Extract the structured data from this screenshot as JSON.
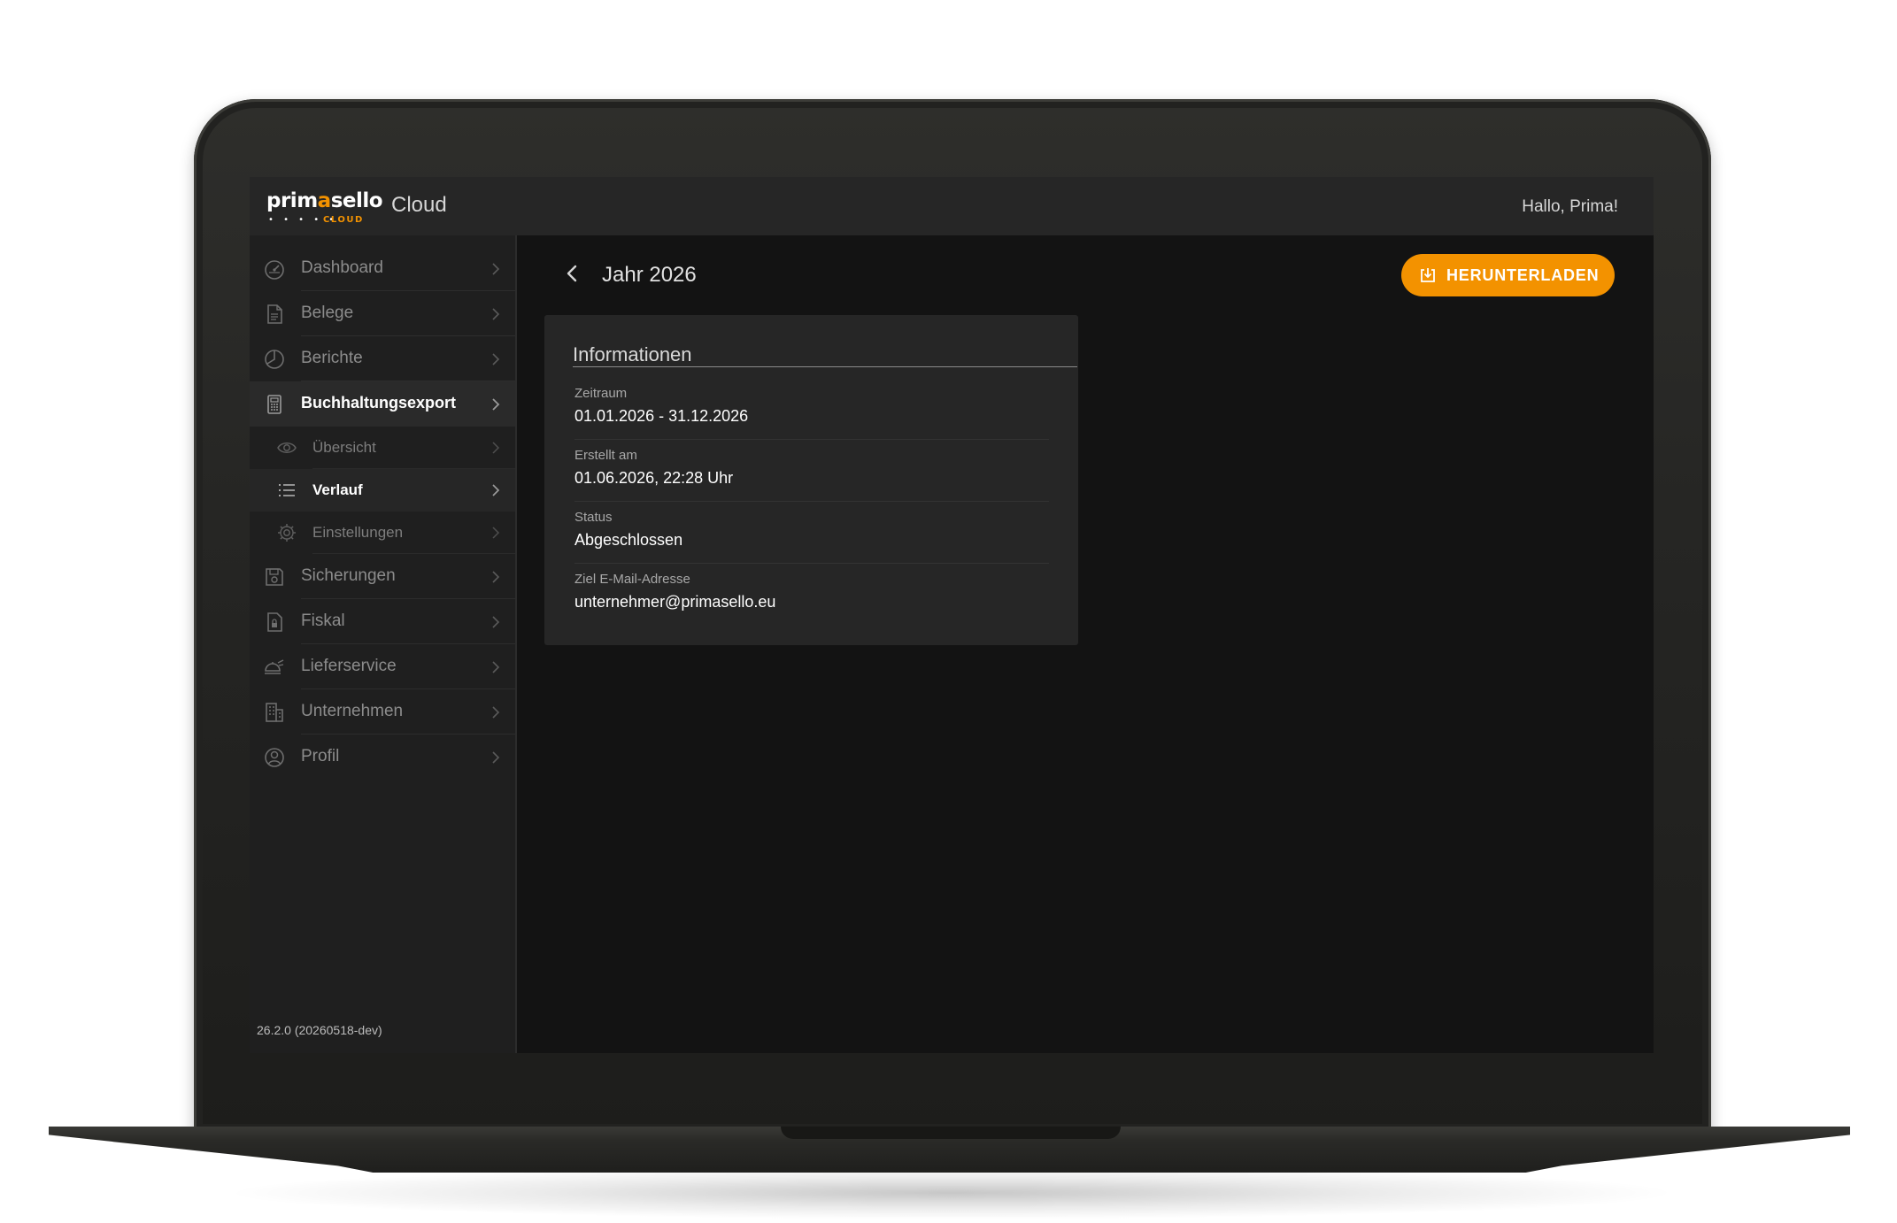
{
  "topbar": {
    "logo": {
      "word_a": "prim",
      "word_b": "a",
      "word_c": "sello",
      "dots": "• • • • •",
      "cloud": "CLOUD"
    },
    "app_title": "Cloud",
    "greeting": "Hallo, Prima!"
  },
  "sidebar": {
    "items": [
      {
        "label": "Dashboard",
        "icon": "dashboard-gauge-icon"
      },
      {
        "label": "Belege",
        "icon": "document-icon"
      },
      {
        "label": "Berichte",
        "icon": "pie-chart-icon"
      },
      {
        "label": "Buchhaltungsexport",
        "icon": "calculator-icon",
        "active": true
      },
      {
        "label": "Sicherungen",
        "icon": "floppy-disk-icon"
      },
      {
        "label": "Fiskal",
        "icon": "lock-document-icon"
      },
      {
        "label": "Lieferservice",
        "icon": "delivery-food-icon"
      },
      {
        "label": "Unternehmen",
        "icon": "building-icon"
      },
      {
        "label": "Profil",
        "icon": "user-circle-icon"
      }
    ],
    "sub_items": [
      {
        "label": "Übersicht",
        "icon": "eye-icon"
      },
      {
        "label": "Verlauf",
        "icon": "list-icon",
        "active": true
      },
      {
        "label": "Einstellungen",
        "icon": "gear-icon"
      }
    ],
    "version": "26.2.0 (20260518-dev)"
  },
  "main": {
    "title": "Jahr 2026",
    "download_label": "HERUNTERLADEN",
    "card": {
      "title": "Informationen",
      "rows": [
        {
          "key": "Zeitraum",
          "value": "01.01.2026 - 31.12.2026"
        },
        {
          "key": "Erstellt am",
          "value": "01.06.2026, 22:28 Uhr"
        },
        {
          "key": "Status",
          "value": "Abgeschlossen"
        },
        {
          "key": "Ziel E-Mail-Adresse",
          "value": "unternehmer@primasello.eu"
        }
      ]
    }
  },
  "colors": {
    "accent": "#f39200",
    "screen_bg": "#131313",
    "topbar_bg": "#262626",
    "sidebar_bg": "#1f1f1f",
    "card_bg": "#262626"
  }
}
